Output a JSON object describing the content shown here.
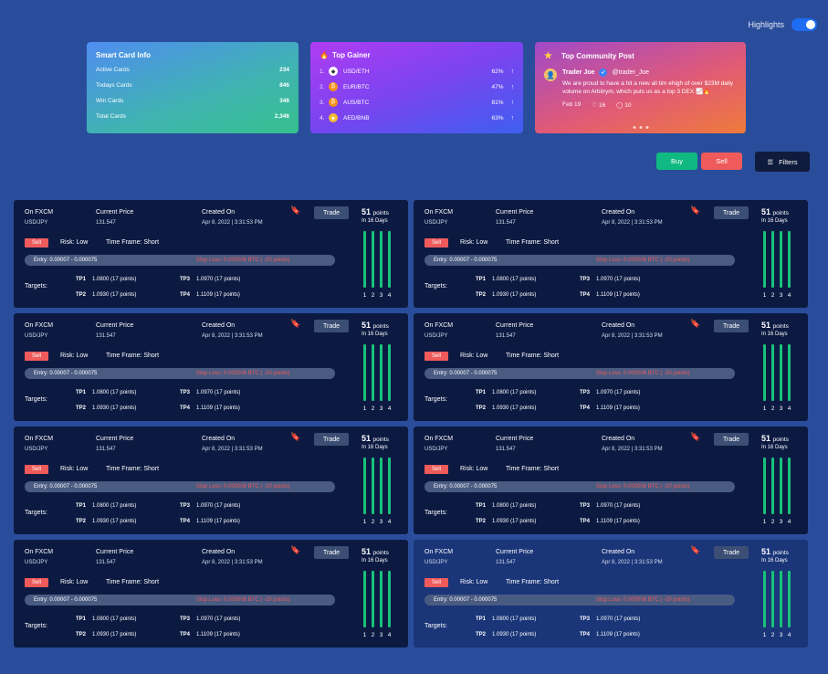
{
  "highlights": {
    "label": "Highlights",
    "enabled": true
  },
  "smart_card": {
    "title": "Smart Card Info",
    "rows": [
      {
        "label": "Active Cards",
        "value": "234"
      },
      {
        "label": "Todays Cards",
        "value": "846"
      },
      {
        "label": "Win Cards",
        "value": "346"
      },
      {
        "label": "Total Cards",
        "value": "2,346"
      }
    ]
  },
  "top_gainer": {
    "title": "Top Gainer",
    "icon": "fire-icon",
    "rows": [
      {
        "rank": "1.",
        "pair": "USD/ETH",
        "pct": "62%",
        "coin_color": "#ffffff"
      },
      {
        "rank": "2.",
        "pair": "EUR/BTC",
        "pct": "47%",
        "coin_color": "#f7931a"
      },
      {
        "rank": "3.",
        "pair": "AUS/BTC",
        "pct": "81%",
        "coin_color": "#f7931a"
      },
      {
        "rank": "4.",
        "pair": "AED/BNB",
        "pct": "63%",
        "coin_color": "#f3ba2f"
      }
    ]
  },
  "community": {
    "title": "Top Community Post",
    "icon": "star-icon",
    "user": "Trader Joe",
    "handle": "@trader_Joe",
    "text": "We are proud to have a hit a new all tim ehigh of over $23M daily volume on Arbitrym, which puts us as a top 3 DEX 📈🔥",
    "date": "Feb 19",
    "likes": "16",
    "comments": "10"
  },
  "actions": {
    "buy": "Buy",
    "sell": "Sell",
    "filters": "Filters"
  },
  "colors": {
    "accent": "#1e6cf2",
    "buy": "#10b981",
    "sell": "#ef5a5a",
    "bar": "#18c27a"
  },
  "trade_card": {
    "exchange": "On FXCM",
    "pair": "USD/JPY",
    "current_price_label": "Current Price",
    "current_price": "131.547",
    "created_label": "Created On",
    "created": "Apr 8, 2022 | 3:31:53 PM",
    "trade": "Trade",
    "points": "51",
    "points_unit": "points",
    "days": "In 16 Days",
    "side": "Sell",
    "risk_label": "Risk:",
    "risk": "Low",
    "tf_label": "Time Frame:",
    "tf": "Short",
    "entry_label": "Entry:",
    "entry": "0.00007 - 0.000075",
    "stop_label": "Stop Loss:",
    "stop": "0.000006 BTC ( -20 points)",
    "targets_label": "Targets:",
    "tp1_label": "TP1",
    "tp1": "1.0800",
    "tp2_label": "TP2",
    "tp2": "1.0930",
    "tp3_label": "TP3",
    "tp3": "1.0970",
    "tp4_label": "TP4",
    "tp4": "1.1109",
    "tp_points": "(17 points)",
    "bar_labels": [
      "1",
      "2",
      "3",
      "4"
    ]
  },
  "card_count": 8
}
